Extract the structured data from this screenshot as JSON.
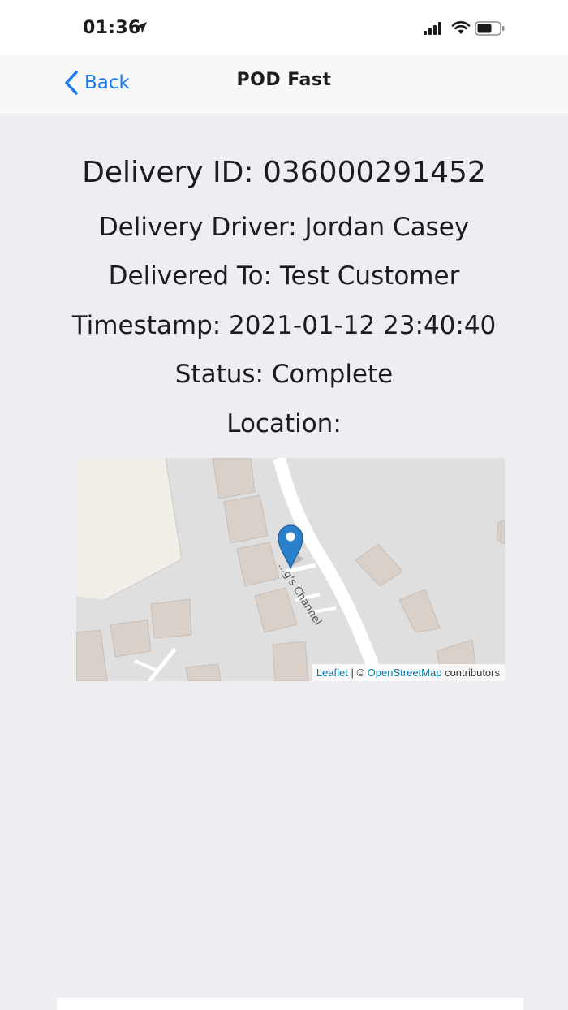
{
  "status_bar": {
    "time": "01:36",
    "icons": [
      "location-arrow-icon",
      "cellular-signal-icon",
      "wifi-icon",
      "battery-icon"
    ]
  },
  "nav": {
    "back_label": "Back",
    "title": "POD Fast"
  },
  "delivery": {
    "id_line": "Delivery ID: 036000291452",
    "driver_line": "Delivery Driver: Jordan Casey",
    "delivered_to_line": "Delivered To: Test Customer",
    "timestamp_line": "Timestamp: 2021-01-12 23:40:40",
    "status_line": "Status: Complete",
    "location_label": "Location:"
  },
  "map": {
    "street_label": "...g's Channel",
    "attribution": {
      "leaflet": "Leaflet",
      "separator": " | © ",
      "osm": "OpenStreetMap",
      "suffix": " contributors"
    },
    "marker_color": "#2a81cb"
  },
  "colors": {
    "accent": "#1a7cf0",
    "background": "#ededf2"
  }
}
